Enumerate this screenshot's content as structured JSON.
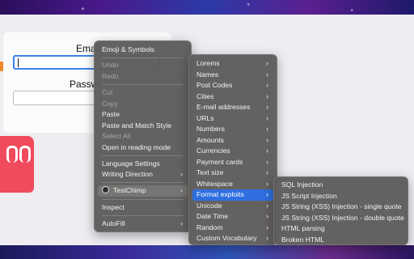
{
  "form": {
    "email_label": "Email:",
    "password_label": "Passwo"
  },
  "context_menu": {
    "items": [
      {
        "label": "Emoji & Symbols"
      },
      {
        "label": "Undo"
      },
      {
        "label": "Redo"
      },
      {
        "label": "Cut"
      },
      {
        "label": "Copy"
      },
      {
        "label": "Paste"
      },
      {
        "label": "Paste and Match Style"
      },
      {
        "label": "Select All"
      },
      {
        "label": "Open in reading mode"
      },
      {
        "label": "Language Settings"
      },
      {
        "label": "Writing Direction"
      },
      {
        "label": "TestChimp"
      },
      {
        "label": "Inspect"
      },
      {
        "label": "AutoFill"
      }
    ]
  },
  "testchimp_menu": {
    "items": [
      {
        "label": "Lorems"
      },
      {
        "label": "Names"
      },
      {
        "label": "Post Codes"
      },
      {
        "label": "Cities"
      },
      {
        "label": "E-mail addresses"
      },
      {
        "label": "URLs"
      },
      {
        "label": "Numbers"
      },
      {
        "label": "Amounts"
      },
      {
        "label": "Currencies"
      },
      {
        "label": "Payment cards"
      },
      {
        "label": "Text size"
      },
      {
        "label": "Whitespace"
      },
      {
        "label": "Format exploits"
      },
      {
        "label": "Unicode"
      },
      {
        "label": "Date Time"
      },
      {
        "label": "Random"
      },
      {
        "label": "Custom Vocabulary"
      }
    ]
  },
  "format_exploits_menu": {
    "items": [
      {
        "label": "SQL Injection"
      },
      {
        "label": "JS Script Injection"
      },
      {
        "label": "JS String (XSS) Injection - single quote"
      },
      {
        "label": "JS String (XSS) Injection - double quote"
      },
      {
        "label": "HTML parsing"
      },
      {
        "label": "Broken HTML"
      }
    ]
  },
  "submenu_arrow": "›",
  "colors": {
    "highlight": "#2f6fe0",
    "menu_bg": "#5f5d5c",
    "focus_ring": "#3b82e8",
    "bag": "#ef4b5c"
  }
}
